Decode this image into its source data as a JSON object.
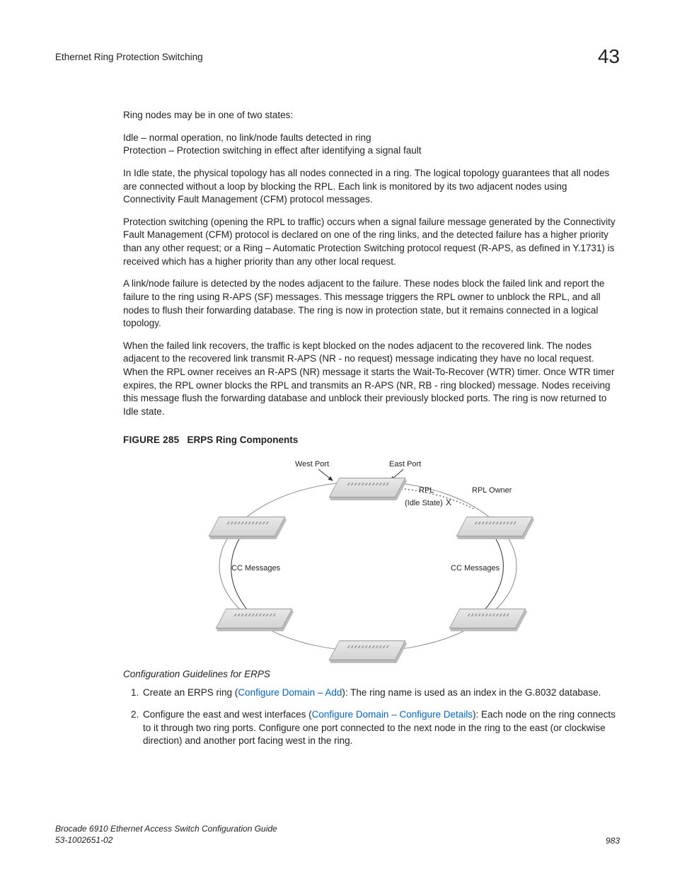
{
  "header": {
    "section_title": "Ethernet Ring Protection Switching",
    "chapter_number": "43"
  },
  "body": {
    "p1": "Ring nodes may be in one of two states:",
    "p2a": "Idle – normal operation, no link/node faults detected in ring",
    "p2b": "Protection – Protection switching in effect after identifying a signal fault",
    "p3": "In Idle state, the physical topology has all nodes connected in a ring. The logical topology guarantees that all nodes are connected without a loop by blocking the RPL. Each link is monitored by its two adjacent nodes using Connectivity Fault Management (CFM) protocol messages.",
    "p4": "Protection switching (opening the RPL to traffic) occurs when a signal failure message generated by the Connectivity Fault Management (CFM) protocol is declared on one of the ring links, and the detected failure has a higher priority than any other request; or a Ring – Automatic Protection Switching protocol request (R-APS, as defined in Y.1731) is received which has a higher priority than any other local request.",
    "p5": "A link/node failure is detected by the nodes adjacent to the failure. These nodes block the failed link and report the failure to the ring using R-APS (SF) messages. This message triggers the RPL owner to unblock the RPL, and all nodes to flush their forwarding database. The ring is now in protection state, but it remains connected in a logical topology.",
    "p6": "When the failed link recovers, the traffic is kept blocked on the nodes adjacent to the recovered link. The nodes adjacent to the recovered link transmit R-APS (NR - no request) message indicating they have no local request. When the RPL owner receives an R-APS (NR) message it starts the Wait-To-Recover (WTR) timer. Once WTR timer expires, the RPL owner blocks the RPL and transmits an R-APS (NR, RB - ring blocked) message. Nodes receiving this message flush the forwarding database and unblock their previously blocked ports. The ring is now returned to Idle state."
  },
  "figure": {
    "label": "FIGURE 285",
    "title": "ERPS Ring Components",
    "labels": {
      "west_port": "West Port",
      "east_port": "East Port",
      "rpl": "RPL",
      "rpl_owner": "RPL Owner",
      "idle_state": "(Idle State)",
      "x": "X",
      "cc_left": "CC Messages",
      "cc_right": "CC Messages"
    }
  },
  "guidelines": {
    "heading": "Configuration Guidelines for ERPS",
    "items": [
      {
        "pre": "Create an ERPS ring (",
        "link": "Configure Domain – Add",
        "post": "): The ring name is used as an index in the G.8032 database."
      },
      {
        "pre": "Configure the east and west interfaces (",
        "link": "Configure Domain – Configure Details",
        "post": "): Each node on the ring connects to it through two ring ports. Configure one port connected to the next node in the ring to the east (or clockwise direction) and another port facing west in the ring."
      }
    ]
  },
  "footer": {
    "doc_title": "Brocade 6910 Ethernet Access Switch Configuration Guide",
    "doc_number": "53-1002651-02",
    "page": "983"
  }
}
